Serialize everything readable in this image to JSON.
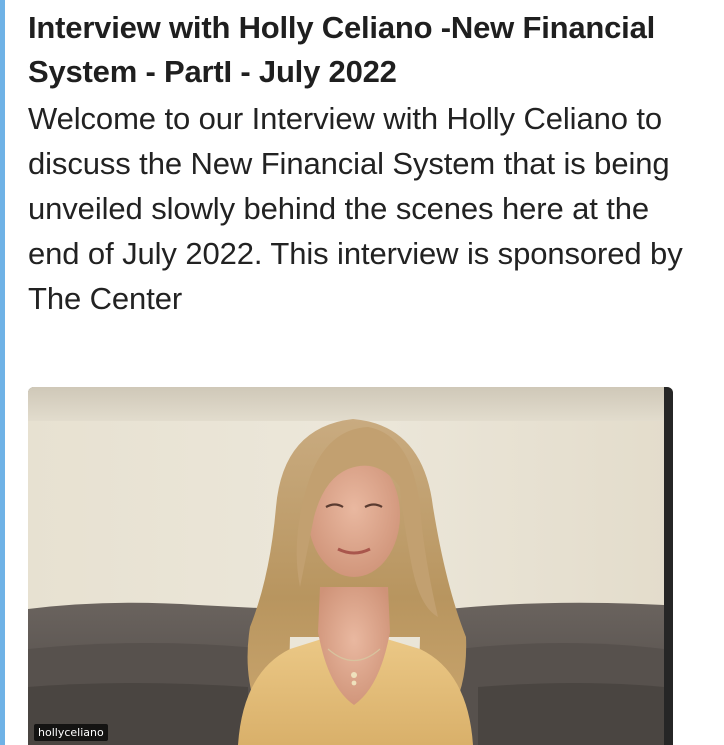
{
  "post": {
    "title": "Interview with Holly Celiano -New Financial System - PartI - July 2022",
    "body": "Welcome to our Interview with Holly Celiano to discuss the New Financial System that is being unveiled slowly behind the scenes here at the end of July 2022. This interview is sponsored by The Center"
  },
  "video": {
    "username": "hollyceliano"
  },
  "colors": {
    "accent_bar": "#6fb2e6",
    "wall": "#e9e3d4",
    "couch": "#5e5854",
    "hair": "#c8a676",
    "top": "#e6c27f"
  }
}
